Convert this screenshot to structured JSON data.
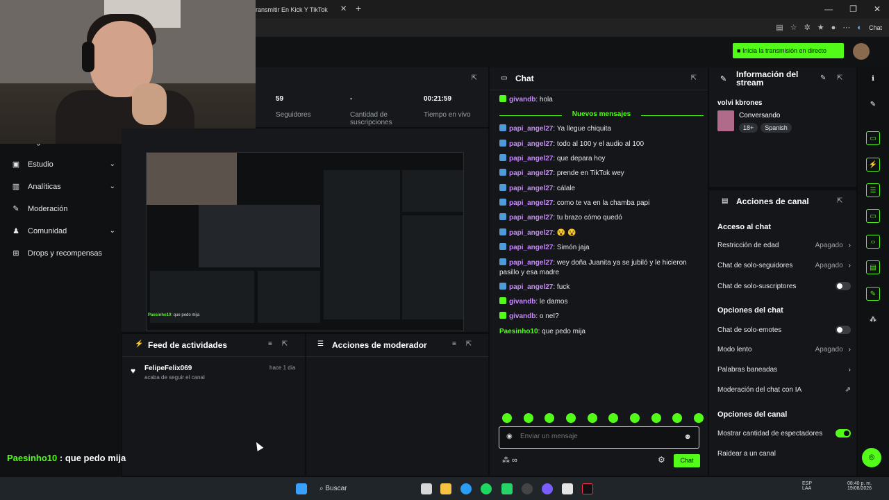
{
  "browser": {
    "tab_title": "ransmitir En Kick Y TikTok",
    "tab_close": "✕",
    "new_tab": "+",
    "chat_label": "Chat",
    "window_controls": [
      "—",
      "❐",
      "✕"
    ]
  },
  "header": {
    "go_live": "Inicia la transmisión en directo"
  },
  "sidebar": {
    "items": [
      {
        "label": "Logros",
        "icon": "trophy-icon"
      },
      {
        "label": "Estudio",
        "icon": "camera-icon",
        "chevron": "⌄"
      },
      {
        "label": "Analíticas",
        "icon": "chart-icon",
        "chevron": "⌄"
      },
      {
        "label": "Moderación",
        "icon": "wrench-icon"
      },
      {
        "label": "Comunidad",
        "icon": "people-icon",
        "chevron": "⌄"
      },
      {
        "label": "Drops y recompensas",
        "icon": "gift-icon"
      }
    ]
  },
  "stats": [
    {
      "value": "59",
      "label": "Seguidores"
    },
    {
      "value": "-",
      "label": "Cantidad de suscripciones"
    },
    {
      "value": "00:21:59",
      "label": "Tiempo en vivo"
    }
  ],
  "preview": {
    "chat_user": "Paesinho10",
    "chat_text": ": que pedo mija"
  },
  "feed": {
    "title": "Feed de actividades",
    "items": [
      {
        "user": "FelipeFelix069",
        "text": "acaba de seguir el canal",
        "time": "hace 1 día"
      }
    ]
  },
  "modactions": {
    "title": "Acciones de moderador"
  },
  "chat": {
    "title": "Chat",
    "new_messages": "Nuevos mensajes",
    "messages": [
      {
        "user": "givandb",
        "text": ": hola",
        "badge": "mod"
      },
      {
        "user": "papi_angel27",
        "text": ": Ya llegue chiquita",
        "badge": "kick"
      },
      {
        "user": "papi_angel27",
        "text": ": todo al 100 y el audio al 100",
        "badge": "kick"
      },
      {
        "user": "papi_angel27",
        "text": ": que depara hoy",
        "badge": "kick"
      },
      {
        "user": "papi_angel27",
        "text": ": prende en TikTok wey",
        "badge": "kick"
      },
      {
        "user": "papi_angel27",
        "text": ": cálale",
        "badge": "kick"
      },
      {
        "user": "papi_angel27",
        "text": ": como te va en la chamba papi",
        "badge": "kick"
      },
      {
        "user": "papi_angel27",
        "text": ": tu brazo cómo quedó",
        "badge": "kick"
      },
      {
        "user": "papi_angel27",
        "text": ": 😵 😵",
        "badge": "kick"
      },
      {
        "user": "papi_angel27",
        "text": ": Simón jaja",
        "badge": "kick"
      },
      {
        "user": "papi_angel27",
        "text": ": wey doña Juanita ya se jubiló y le hicieron pasillo y esa madre",
        "badge": "kick"
      },
      {
        "user": "papi_angel27",
        "text": ": fuck",
        "badge": "kick"
      },
      {
        "user": "givandb",
        "text": ": le damos",
        "badge": "mod"
      },
      {
        "user": "givandb",
        "text": ": o neI?",
        "badge": "mod"
      },
      {
        "user": "Paesinho10",
        "text": ": que pedo mija",
        "badge": "none"
      }
    ],
    "input_placeholder": "Enviar un mensaje",
    "send_label": "Chat"
  },
  "stream_info": {
    "title": "Información del stream",
    "stream_title": "volvi kbrones",
    "category": "Conversando",
    "tags": [
      "18+",
      "Spanish"
    ]
  },
  "channel_actions": {
    "title": "Acciones de canal",
    "sections": {
      "chat_access": "Acceso al chat",
      "chat_options": "Opciones del chat",
      "channel_options": "Opciones del canal"
    },
    "rows": {
      "age": {
        "label": "Restricción de edad",
        "value": "Apagado"
      },
      "followers": {
        "label": "Chat de solo-seguidores",
        "value": "Apagado"
      },
      "subs": {
        "label": "Chat de solo-suscriptores"
      },
      "emotes": {
        "label": "Chat de solo-emotes"
      },
      "slow": {
        "label": "Modo lento",
        "value": "Apagado"
      },
      "banned": {
        "label": "Palabras baneadas"
      },
      "ai": {
        "label": "Moderación del chat con IA"
      },
      "viewers": {
        "label": "Mostrar cantidad de espectadores"
      },
      "raid": {
        "label": "Raidear a un canal"
      }
    }
  },
  "taskbar": {
    "search": "Buscar",
    "lang": "ESP",
    "lang2": "LAA",
    "time": "08:40 p. m.",
    "date": "19/08/2026"
  },
  "overlay": {
    "user": "Paesinho10",
    "text": " : que pedo mija"
  }
}
